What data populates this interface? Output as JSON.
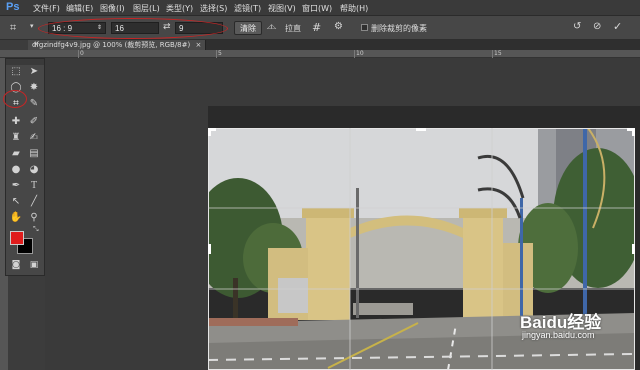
{
  "app": {
    "logo": "Ps"
  },
  "menu": [
    "文件(F)",
    "编辑(E)",
    "图像(I)",
    "图层(L)",
    "类型(Y)",
    "选择(S)",
    "滤镜(T)",
    "视图(V)",
    "窗口(W)",
    "帮助(H)"
  ],
  "options": {
    "ratio": "16 : 9",
    "width": "16",
    "height": "9",
    "clear_button": "清除",
    "straighten_label": "拉直",
    "delete_cropped_label": "删除裁剪的像素"
  },
  "document": {
    "tab_title": "dfgzindfg4v9.jpg @ 100% (裁剪预览, RGB/8#)"
  },
  "ruler_labels": [
    "0",
    "5",
    "10",
    "15"
  ],
  "watermark": {
    "brand": "Baidu经验",
    "url": "jingyan.baidu.com"
  },
  "colors": {
    "foreground": "#e01c1c",
    "background": "#000000",
    "annotation": "#c42626"
  }
}
